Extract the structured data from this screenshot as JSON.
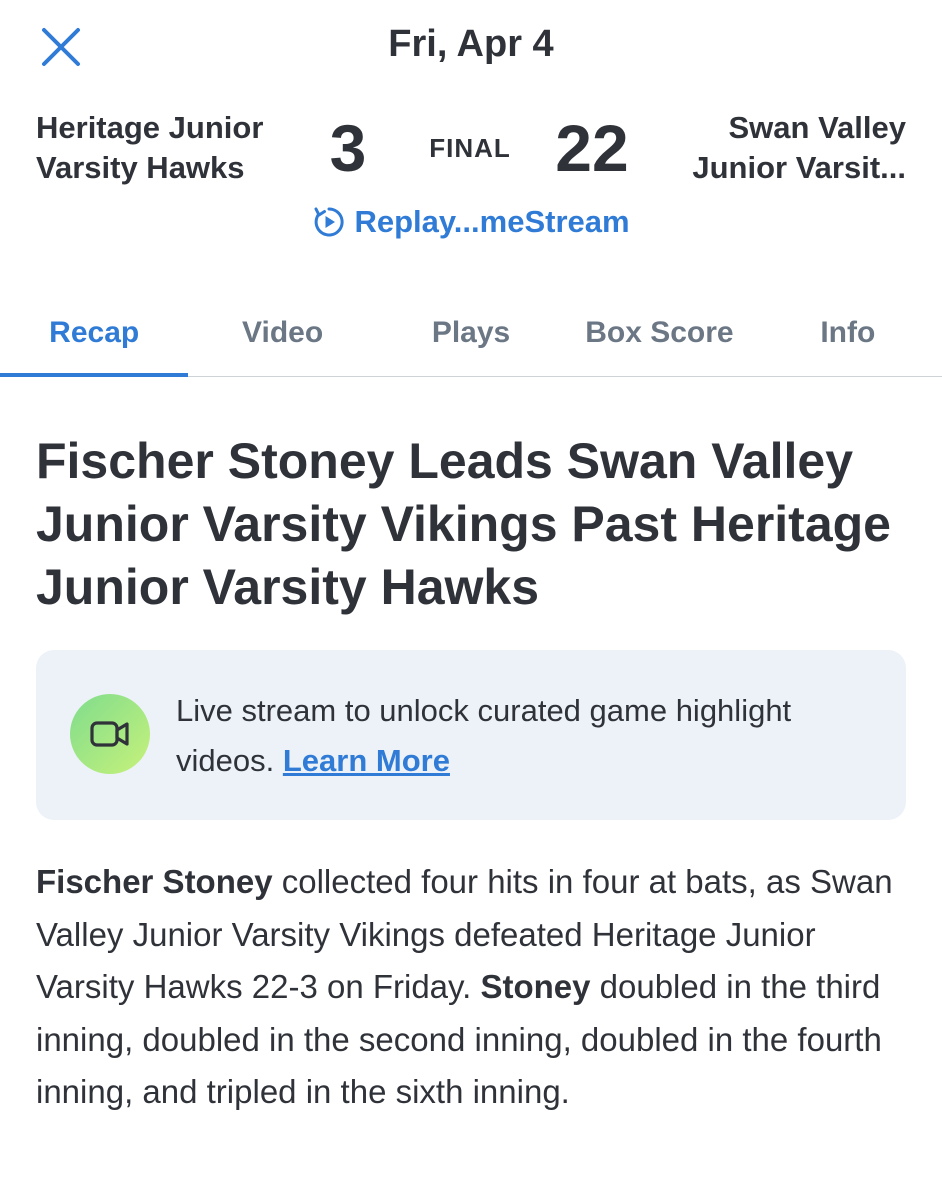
{
  "header": {
    "close_icon": "close-icon",
    "date": "Fri, Apr 4"
  },
  "scoreboard": {
    "home_team_line1": "Heritage Junior",
    "home_team_line2": "Varsity Hawks",
    "home_score": "3",
    "status": "FINAL",
    "away_score": "22",
    "away_team_line1": "Swan Valley",
    "away_team_line2": "Junior Varsit...",
    "replay_icon": "replay-icon",
    "replay_label": "Replay...meStream"
  },
  "tabs": [
    {
      "label": "Recap",
      "active": true
    },
    {
      "label": "Video",
      "active": false
    },
    {
      "label": "Plays",
      "active": false
    },
    {
      "label": "Box Score",
      "active": false
    },
    {
      "label": "Info",
      "active": false
    }
  ],
  "article": {
    "headline": "Fischer Stoney Leads Swan Valley Junior Varsity Vikings Past Heritage Junior Varsity Hawks",
    "promo": {
      "icon": "video-camera-icon",
      "text": "Live stream to unlock curated game highlight videos.",
      "link_label": "Learn More"
    },
    "body": {
      "bold_name_1": "Fischer Stoney",
      "sentence_1": " collected four hits in four at bats, as Swan Valley Junior Varsity Vikings defeated Heritage Junior Varsity Hawks 22-3 on Friday.",
      "bold_name_2": "Stoney",
      "sentence_2": " doubled in the third inning, doubled in the second inning, doubled in the fourth inning, and tripled in the sixth inning."
    }
  },
  "colors": {
    "accent": "#2f7bd6",
    "text": "#2f3239",
    "tab_inactive": "#6b7784",
    "card_bg": "#edf2f8"
  }
}
